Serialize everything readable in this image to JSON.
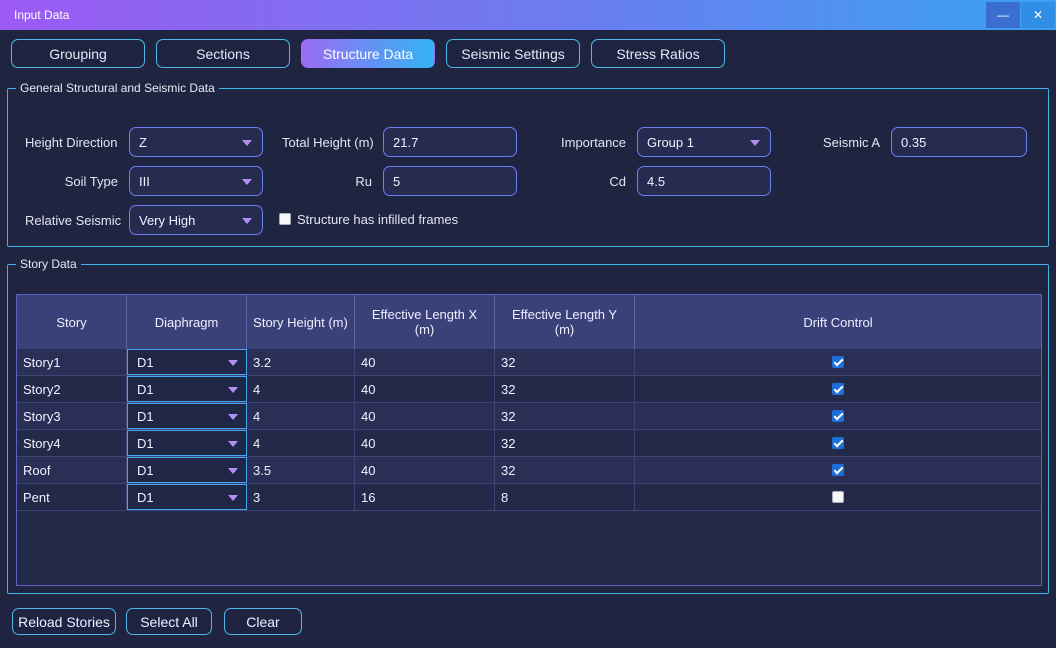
{
  "window": {
    "title": "Input Data",
    "minimize_label": "—",
    "close_label": "✕"
  },
  "tabs": [
    {
      "label": "Grouping",
      "active": false
    },
    {
      "label": "Sections",
      "active": false
    },
    {
      "label": "Structure Data",
      "active": true
    },
    {
      "label": "Seismic Settings",
      "active": false
    },
    {
      "label": "Stress Ratios",
      "active": false
    }
  ],
  "general": {
    "title": "General Structural and Seismic Data",
    "height_direction_label": "Height Direction",
    "height_direction_value": "Z",
    "soil_type_label": "Soil Type",
    "soil_type_value": "III",
    "relative_seismic_label": "Relative Seismic",
    "relative_seismic_value": "Very High",
    "total_height_label": "Total Height (m)",
    "total_height_value": "21.7",
    "ru_label": "Ru",
    "ru_value": "5",
    "importance_label": "Importance",
    "importance_value": "Group 1",
    "cd_label": "Cd",
    "cd_value": "4.5",
    "seismic_a_label": "Seismic A",
    "seismic_a_value": "0.35",
    "infilled_label": "Structure has infilled frames",
    "infilled_checked": false
  },
  "story_data": {
    "title": "Story Data",
    "columns": [
      "Story",
      "Diaphragm",
      "Story Height (m)",
      "Effective Length X\n(m)",
      "Effective Length Y\n(m)",
      "Drift Control"
    ],
    "rows": [
      {
        "story": "Story1",
        "diaphragm": "D1",
        "height": "3.2",
        "lx": "40",
        "ly": "32",
        "drift": true
      },
      {
        "story": "Story2",
        "diaphragm": "D1",
        "height": "4",
        "lx": "40",
        "ly": "32",
        "drift": true
      },
      {
        "story": "Story3",
        "diaphragm": "D1",
        "height": "4",
        "lx": "40",
        "ly": "32",
        "drift": true
      },
      {
        "story": "Story4",
        "diaphragm": "D1",
        "height": "4",
        "lx": "40",
        "ly": "32",
        "drift": true
      },
      {
        "story": "Roof",
        "diaphragm": "D1",
        "height": "3.5",
        "lx": "40",
        "ly": "32",
        "drift": true
      },
      {
        "story": "Pent",
        "diaphragm": "D1",
        "height": "3",
        "lx": "16",
        "ly": "8",
        "drift": false
      }
    ]
  },
  "footer": {
    "reload_label": "Reload Stories",
    "select_all_label": "Select All",
    "clear_label": "Clear"
  }
}
